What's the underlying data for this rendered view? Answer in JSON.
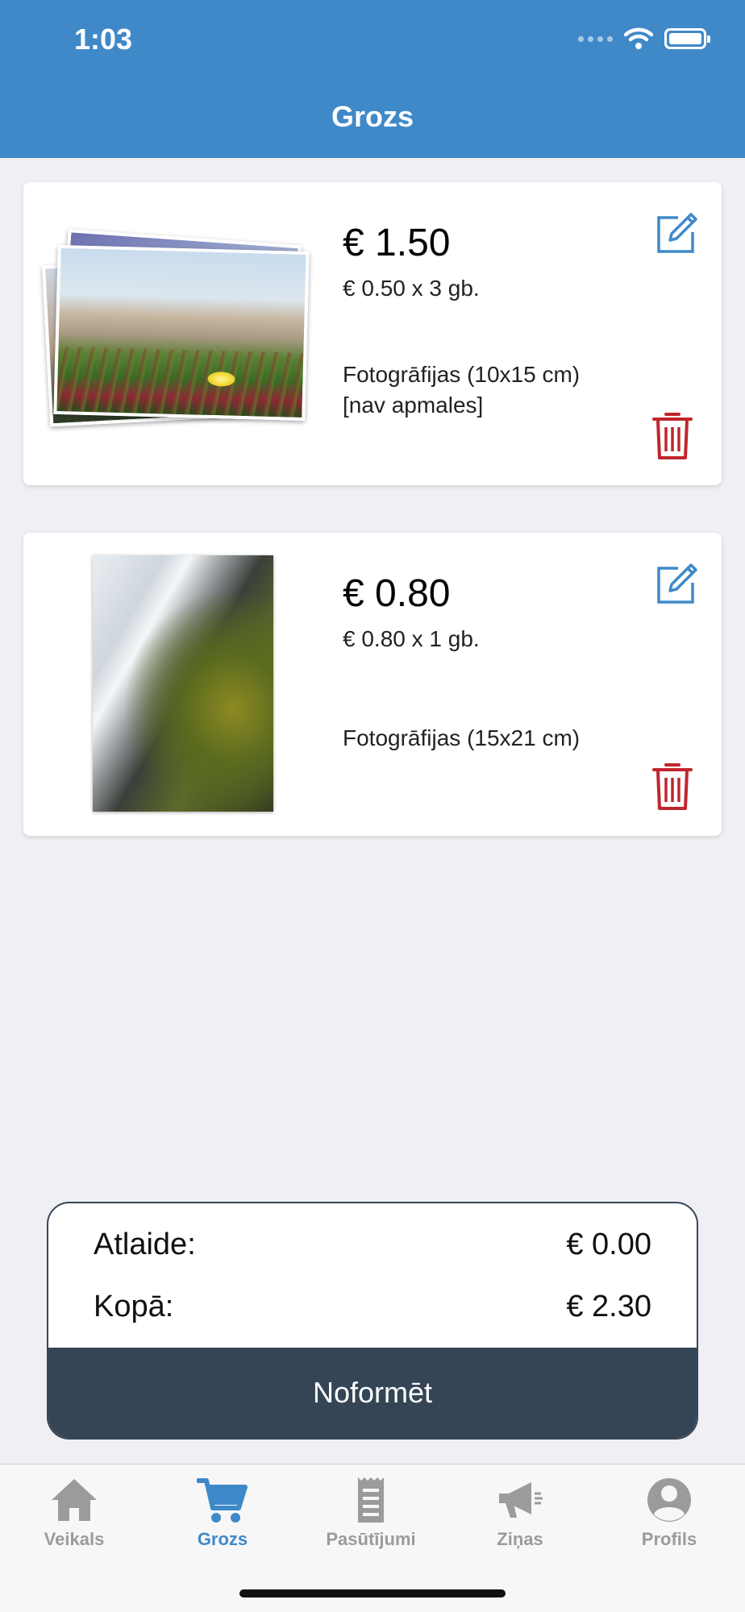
{
  "status_bar": {
    "time": "1:03"
  },
  "header": {
    "title": "Grozs"
  },
  "cart_items": [
    {
      "price": "€ 1.50",
      "unit_line": "€ 0.50 x 3 gb.",
      "description_lines": [
        "Fotogrāfijas (10x15 cm)",
        "[nav apmales]"
      ]
    },
    {
      "price": "€ 0.80",
      "unit_line": "€ 0.80 x 1 gb.",
      "description_lines": [
        "Fotogrāfijas (15x21 cm)"
      ]
    }
  ],
  "summary": {
    "discount_label": "Atlaide:",
    "discount_value": "€ 0.00",
    "total_label": "Kopā:",
    "total_value": "€ 2.30",
    "checkout_label": "Noformēt"
  },
  "tabs": [
    {
      "label": "Veikals",
      "icon": "home-icon",
      "active": false
    },
    {
      "label": "Grozs",
      "icon": "cart-icon",
      "active": true
    },
    {
      "label": "Pasūtījumi",
      "icon": "receipt-icon",
      "active": false
    },
    {
      "label": "Ziņas",
      "icon": "megaphone-icon",
      "active": false
    },
    {
      "label": "Profils",
      "icon": "profile-icon",
      "active": false
    }
  ],
  "colors": {
    "header_bg": "#3f89c9",
    "accent": "#3f89c9",
    "delete": "#c0262d",
    "checkout_bg": "#354556",
    "inactive_tab": "#9b9b9b"
  }
}
